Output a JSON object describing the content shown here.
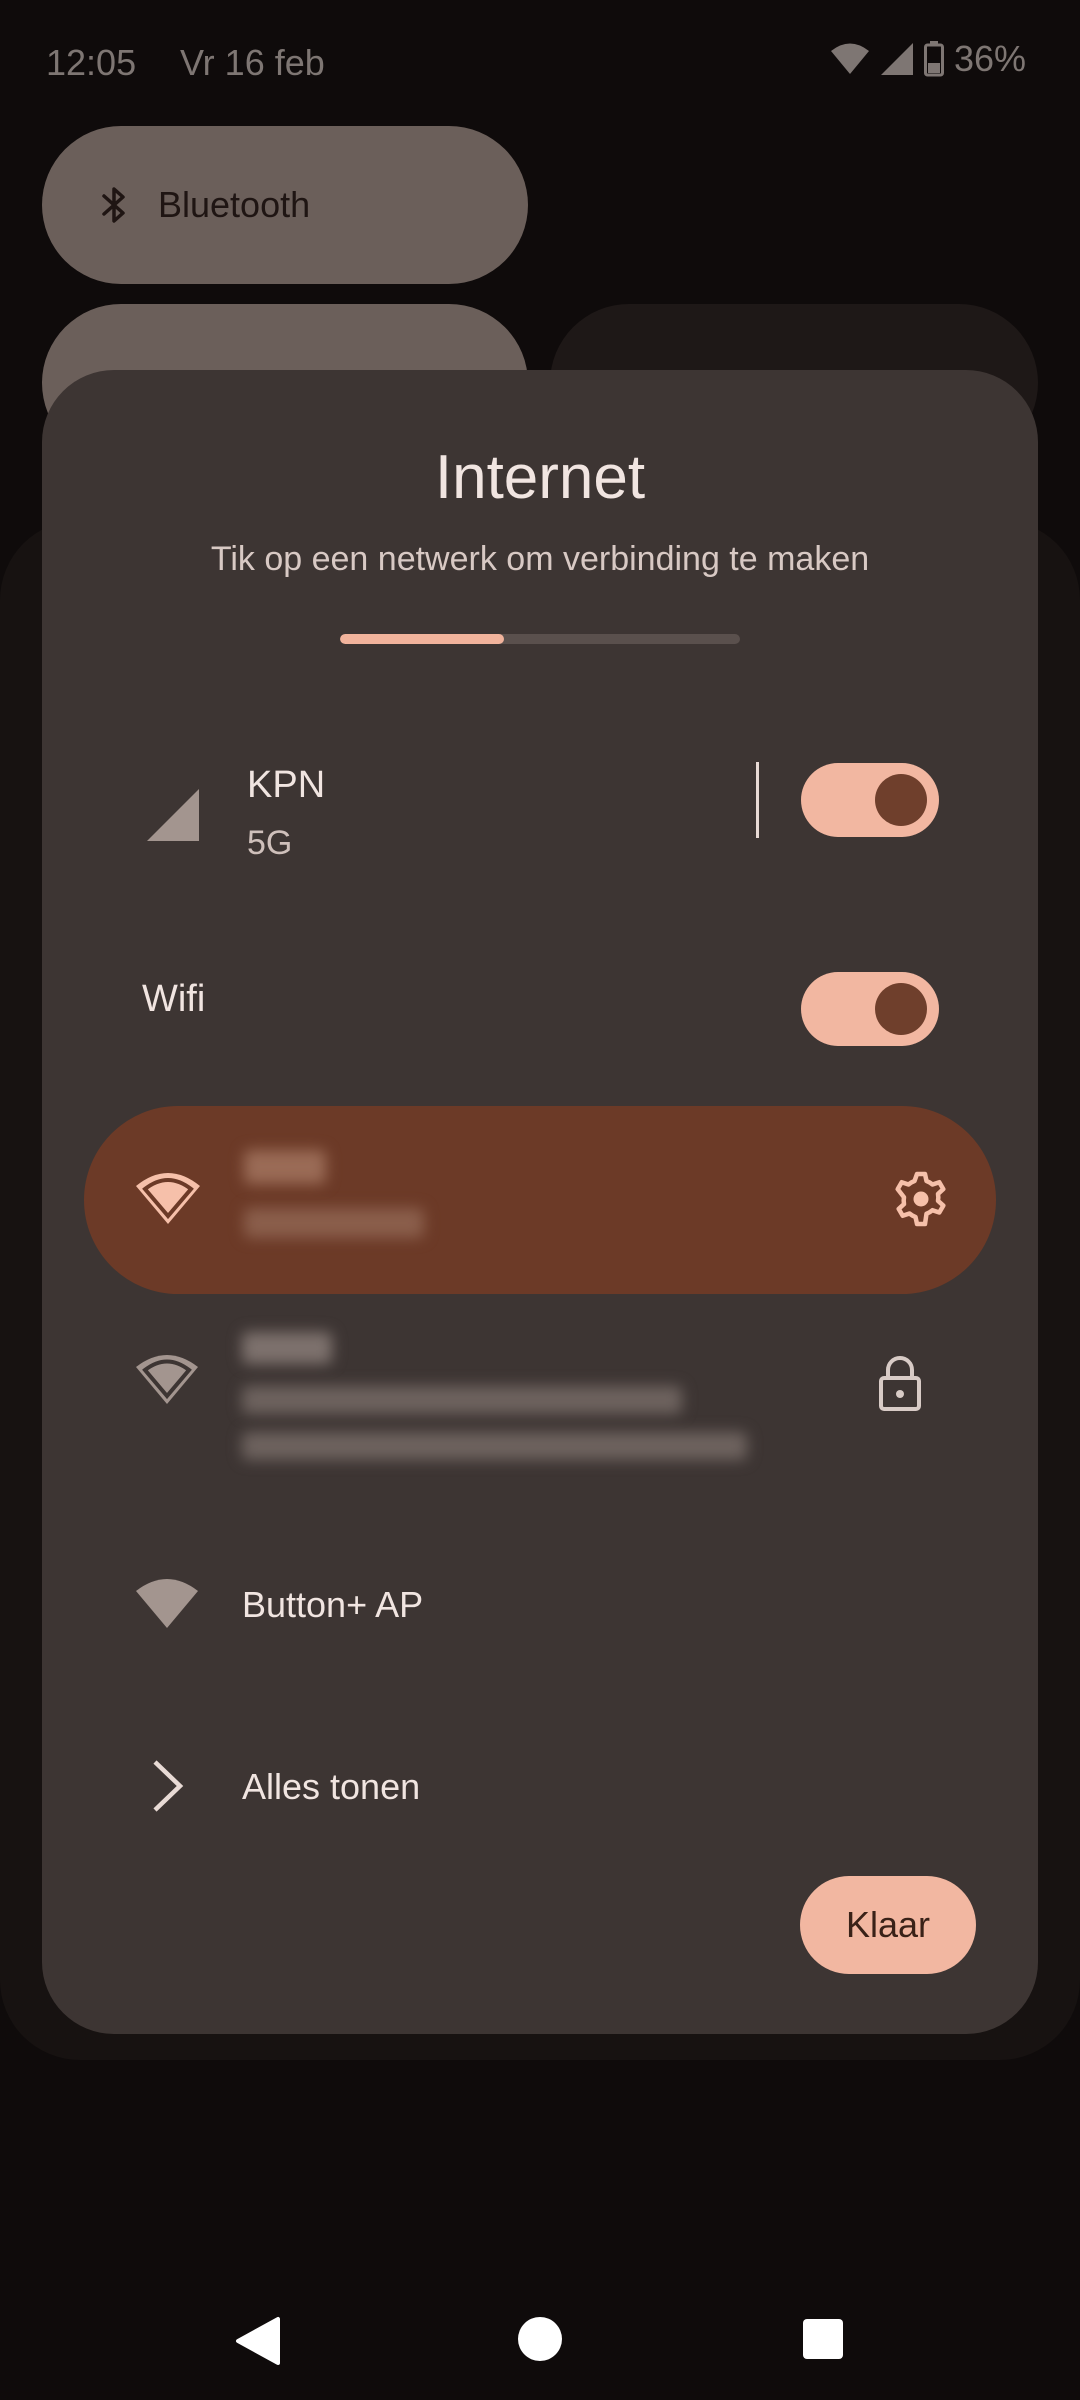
{
  "status_bar": {
    "time": "12:05",
    "date": "Vr 16 feb",
    "battery": "36%",
    "icons": [
      "wifi-icon",
      "cellular-signal-icon",
      "battery-icon"
    ]
  },
  "quick_settings": {
    "bluetooth_label": "Bluetooth",
    "bluetooth_icon": "bluetooth-icon"
  },
  "dialog": {
    "title": "Internet",
    "subtitle": "Tik op een netwerk om verbinding te maken",
    "progress_fraction": 0.41,
    "mobile": {
      "name": "KPN",
      "type": "5G",
      "enabled": true
    },
    "wifi": {
      "label": "Wifi",
      "enabled": true
    },
    "networks": {
      "visible": [
        {
          "name": "Button+ AP",
          "icon": "wifi-icon"
        }
      ]
    },
    "see_all_label": "Alles tonen",
    "done_label": "Klaar"
  },
  "colors": {
    "accent": "#f2b7a1",
    "accent_dark": "#6f3f2c",
    "connected_row": "#6c3a27",
    "dialog_bg": "#3d3533",
    "screen_bg": "#0f0b0b"
  },
  "nav_bar": {
    "icons": [
      "back-icon",
      "home-icon",
      "recents-icon"
    ]
  }
}
